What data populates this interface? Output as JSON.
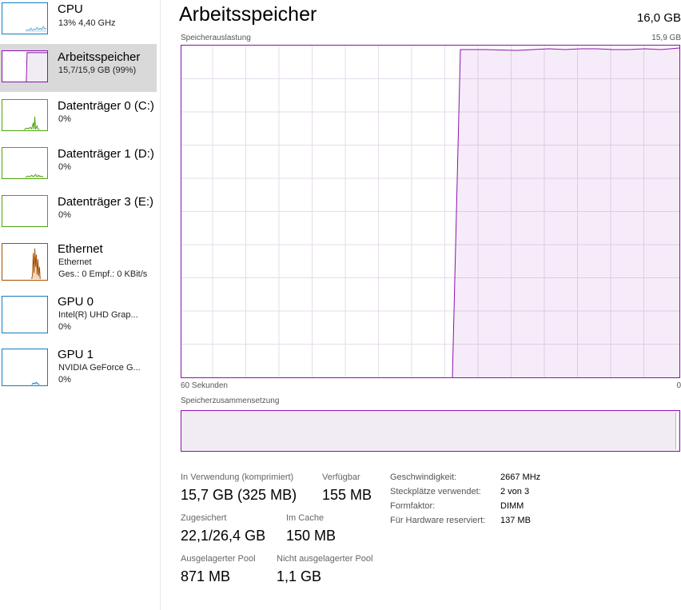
{
  "sidebar": {
    "items": [
      {
        "title": "CPU",
        "sub1": "13%  4,40 GHz",
        "sub2": ""
      },
      {
        "title": "Arbeitsspeicher",
        "sub1": "15,7/15,9 GB (99%)",
        "sub2": ""
      },
      {
        "title": "Datenträger 0 (C:)",
        "sub1": "0%",
        "sub2": ""
      },
      {
        "title": "Datenträger 1 (D:)",
        "sub1": "0%",
        "sub2": ""
      },
      {
        "title": "Datenträger 3 (E:)",
        "sub1": "0%",
        "sub2": ""
      },
      {
        "title": "Ethernet",
        "sub1": "Ethernet",
        "sub2": "Ges.: 0  Empf.: 0 KBit/s"
      },
      {
        "title": "GPU 0",
        "sub1": "Intel(R) UHD Grap...",
        "sub2": "0%"
      },
      {
        "title": "GPU 1",
        "sub1": "NVIDIA GeForce G...",
        "sub2": "0%"
      }
    ]
  },
  "header": {
    "title": "Arbeitsspeicher",
    "total": "16,0 GB"
  },
  "graph": {
    "caption": "Speicherauslastung",
    "max_label": "15,9 GB",
    "time_left": "60 Sekunden",
    "time_right": "0",
    "composition_caption": "Speicherzusammensetzung"
  },
  "stats": {
    "in_use_label": "In Verwendung (komprimiert)",
    "in_use_value": "15,7 GB (325 MB)",
    "available_label": "Verfügbar",
    "available_value": "155 MB",
    "committed_label": "Zugesichert",
    "committed_value": "22,1/26,4 GB",
    "cached_label": "Im Cache",
    "cached_value": "150 MB",
    "paged_label": "Ausgelagerter Pool",
    "paged_value": "871 MB",
    "nonpaged_label": "Nicht ausgelagerter Pool",
    "nonpaged_value": "1,1 GB"
  },
  "properties": [
    {
      "label": "Geschwindigkeit:",
      "value": "2667 MHz"
    },
    {
      "label": "Steckplätze verwendet:",
      "value": "2 von 3"
    },
    {
      "label": "Formfaktor:",
      "value": "DIMM"
    },
    {
      "label": "Für Hardware reserviert:",
      "value": "137 MB"
    }
  ],
  "colors": {
    "memory": "#8b12ae",
    "memory_fill": "#f1ecf4",
    "cpu": "#117dbb",
    "disk": "#4da60c",
    "ethernet": "#a74f01",
    "gpu": "#117dbb",
    "grid": "#e6dbea"
  }
}
